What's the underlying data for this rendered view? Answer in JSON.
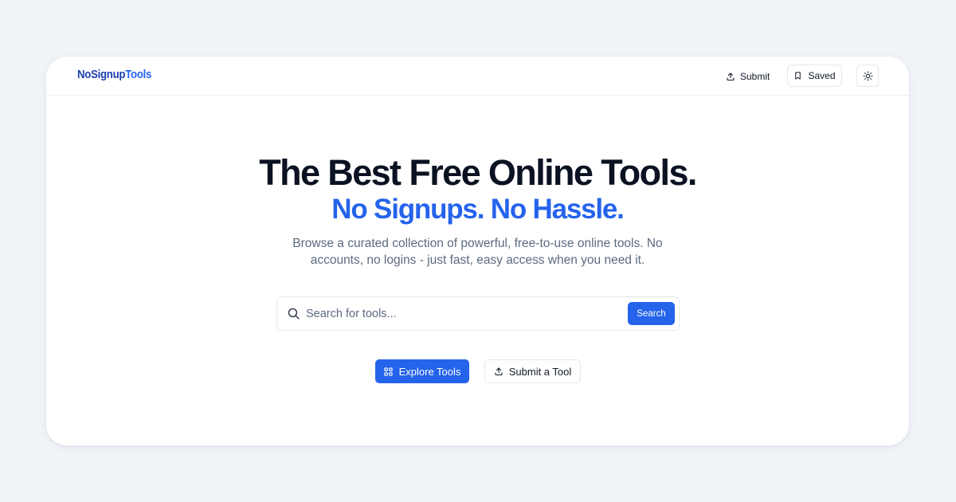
{
  "brand": {
    "logo_part1": "NoSignup",
    "logo_part2": "Tools"
  },
  "nav": {
    "submit_label": "Submit",
    "saved_label": "Saved"
  },
  "hero": {
    "title": "The Best Free Online Tools.",
    "subtitle": "No Signups. No Hassle.",
    "description_line1": "Browse a curated collection of powerful, free-to-use online tools. No",
    "description_line2": "accounts, no logins - just fast, easy access when you need it."
  },
  "search": {
    "placeholder": "Search for tools...",
    "button_label": "Search"
  },
  "cta": {
    "explore_label": "Explore Tools",
    "submit_tool_label": "Submit a Tool"
  },
  "icons": {
    "upload": "upload-icon",
    "bookmark": "bookmark-icon",
    "theme": "sun-icon",
    "search": "search-icon",
    "grid": "grid-icon"
  },
  "colors": {
    "accent": "#2563eb",
    "logo_dark": "#1d3fae",
    "heading": "#0b1222",
    "muted_text": "#5c6a80",
    "page_background": "#f0f3f8",
    "card_background": "#ffffff"
  }
}
